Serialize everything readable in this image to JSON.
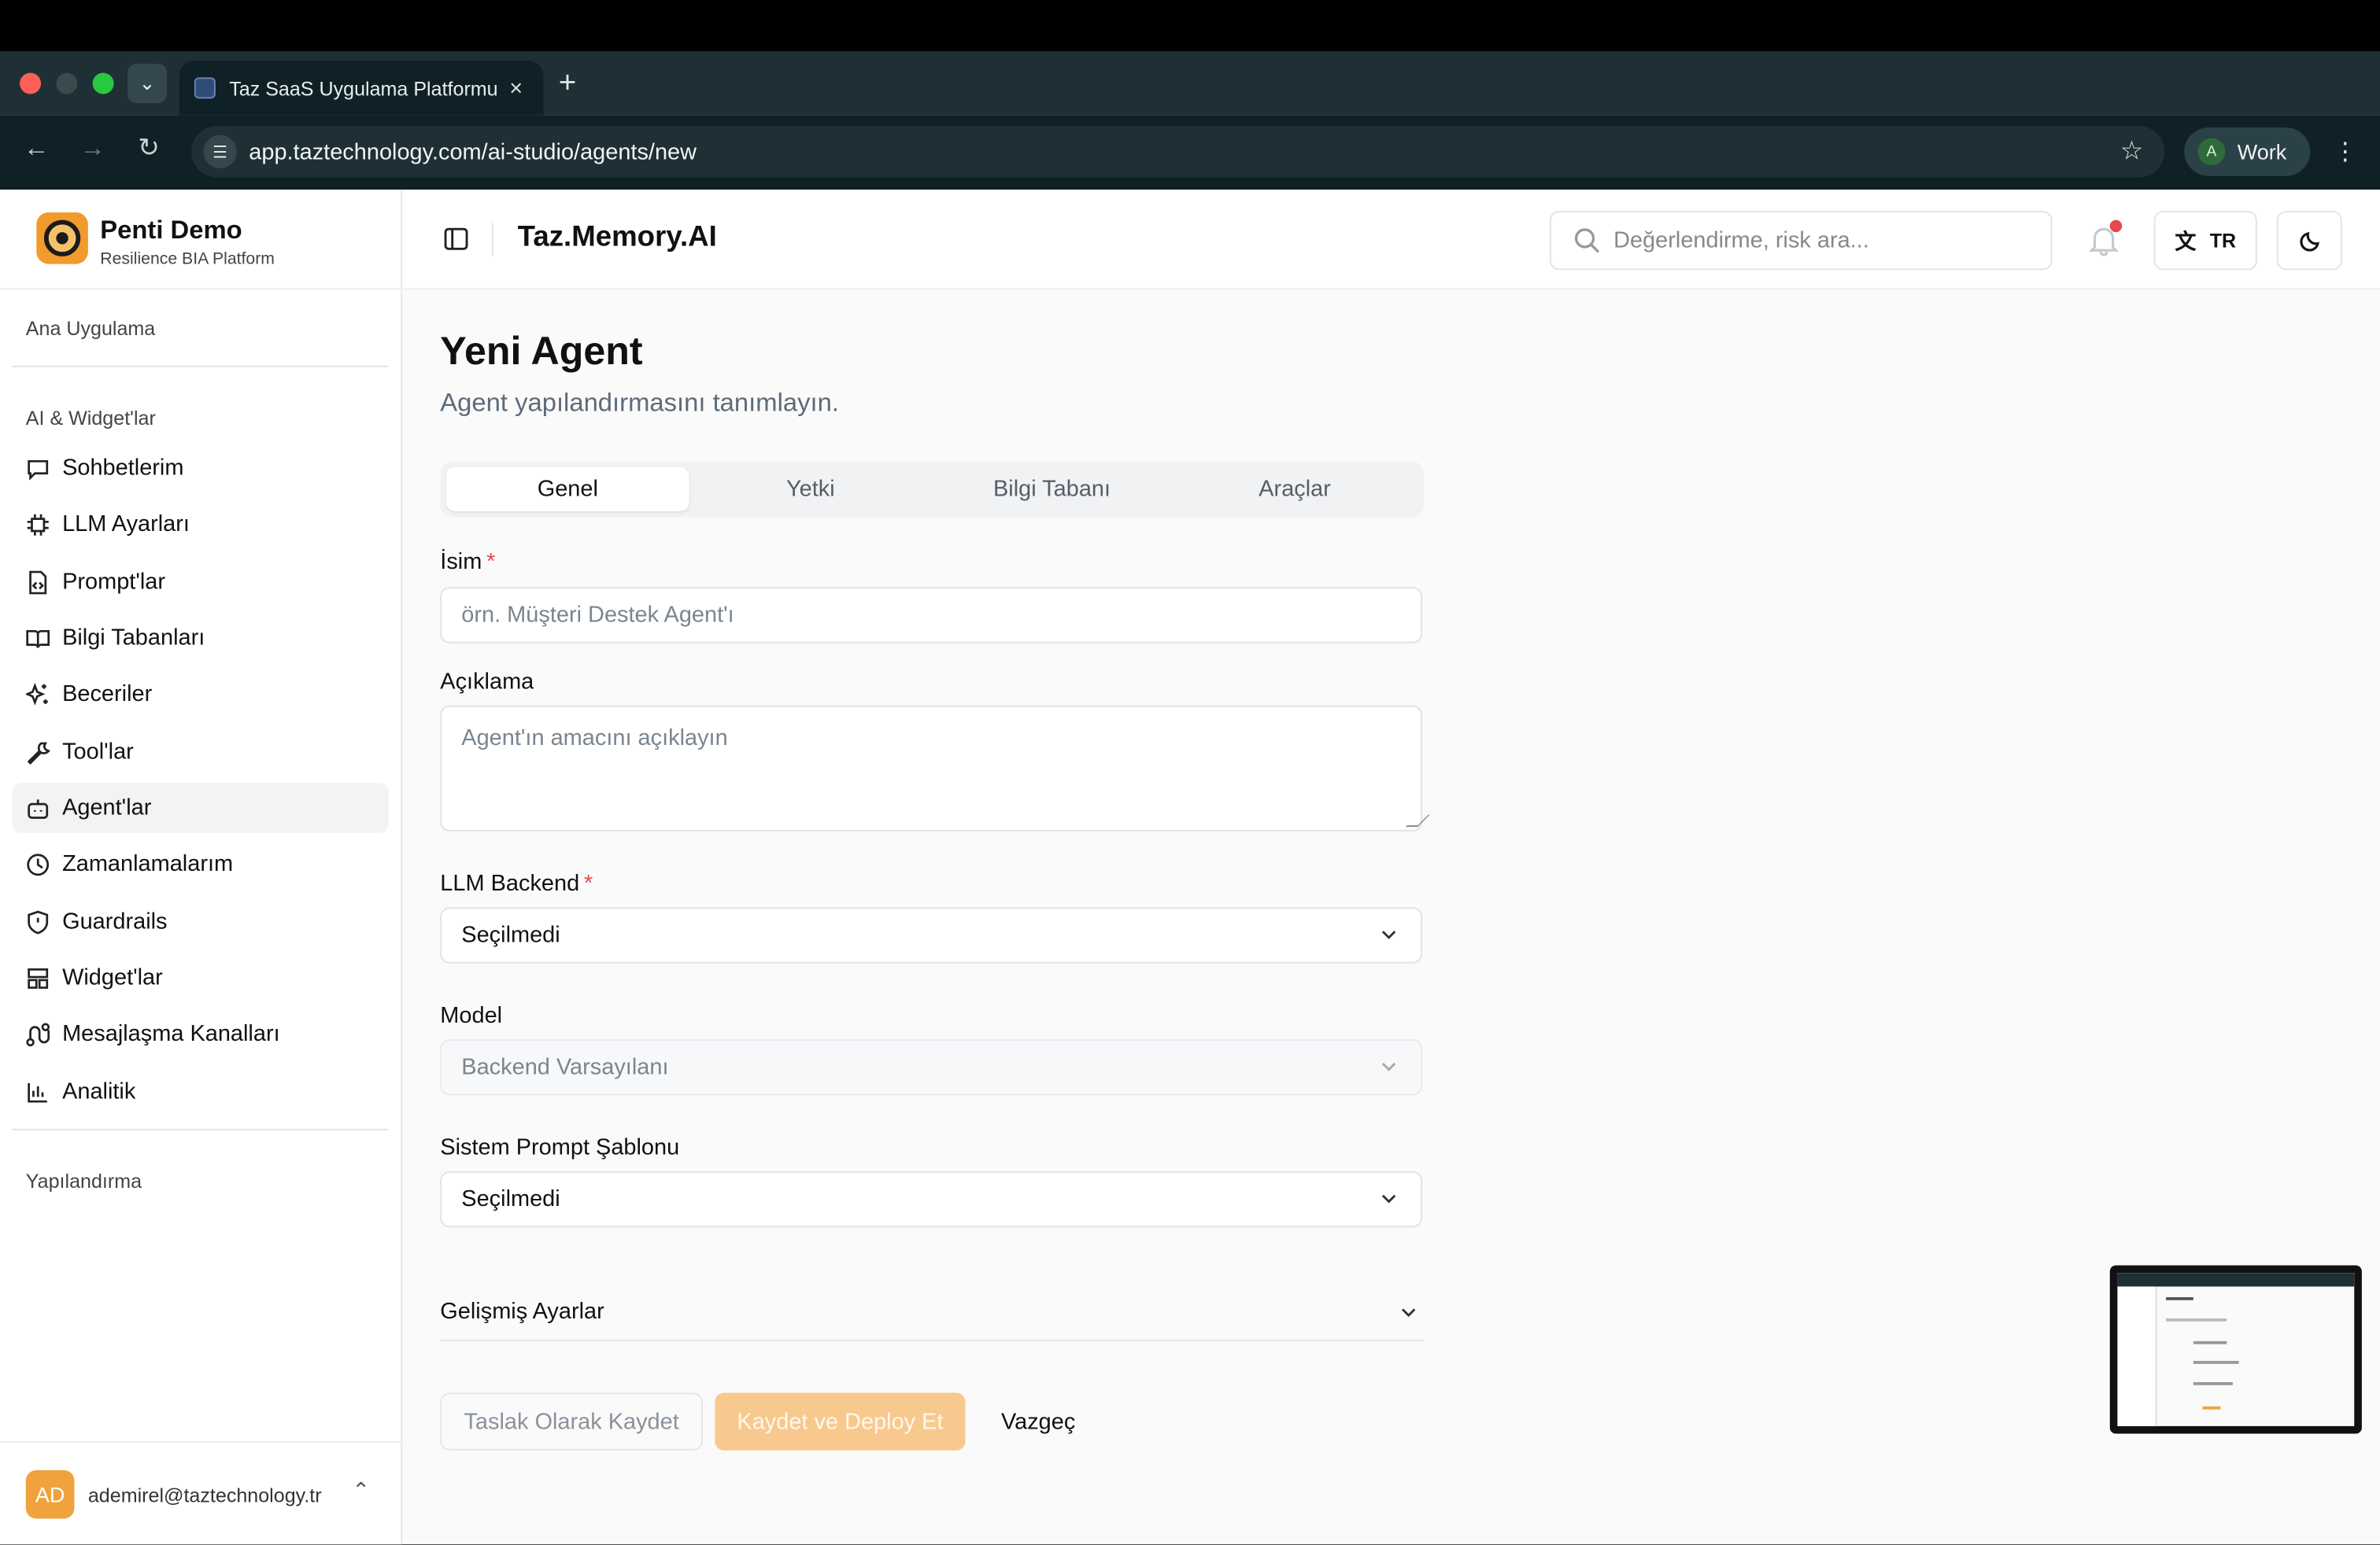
{
  "browser": {
    "tab_title": "Taz SaaS Uygulama Platformu",
    "url": "app.taztechnology.com/ai-studio/agents/new",
    "profile_initial": "A",
    "profile_name": "Work"
  },
  "brand": {
    "name": "Penti Demo",
    "subtitle": "Resilience BIA Platform"
  },
  "sidebar": {
    "group_main": "Ana Uygulama",
    "group_ai": "AI & Widget'lar",
    "group_config": "Yapılandırma",
    "items": [
      {
        "label": "Sohbetlerim",
        "icon": "chat-icon"
      },
      {
        "label": "LLM Ayarları",
        "icon": "chip-icon"
      },
      {
        "label": "Prompt'lar",
        "icon": "file-code-icon"
      },
      {
        "label": "Bilgi Tabanları",
        "icon": "book-icon"
      },
      {
        "label": "Beceriler",
        "icon": "sparkles-icon"
      },
      {
        "label": "Tool'lar",
        "icon": "wrench-icon"
      },
      {
        "label": "Agent'lar",
        "icon": "bot-icon",
        "active": true
      },
      {
        "label": "Zamanlamalarım",
        "icon": "clock-icon"
      },
      {
        "label": "Guardrails",
        "icon": "shield-icon"
      },
      {
        "label": "Widget'lar",
        "icon": "layout-icon"
      },
      {
        "label": "Mesajlaşma Kanalları",
        "icon": "route-icon"
      },
      {
        "label": "Analitik",
        "icon": "bar-chart-icon"
      }
    ],
    "user_initials": "AD",
    "user_email": "ademirel@taztechnology.tr"
  },
  "header": {
    "title": "Taz.Memory.AI",
    "search_placeholder": "Değerlendirme, risk ara...",
    "lang": "TR"
  },
  "page": {
    "title": "Yeni Agent",
    "subtitle": "Agent yapılandırmasını tanımlayın.",
    "tabs": [
      "Genel",
      "Yetki",
      "Bilgi Tabanı",
      "Araçlar"
    ],
    "active_tab": "Genel"
  },
  "form": {
    "name_label": "İsim",
    "name_placeholder": "örn. Müşteri Destek Agent'ı",
    "desc_label": "Açıklama",
    "desc_placeholder": "Agent'ın amacını açıklayın",
    "backend_label": "LLM Backend",
    "backend_value": "Seçilmedi",
    "model_label": "Model",
    "model_value": "Backend Varsayılanı",
    "prompt_label": "Sistem Prompt Şablonu",
    "prompt_value": "Seçilmedi",
    "required_mark": "*",
    "advanced_label": "Gelişmiş Ayarlar"
  },
  "actions": {
    "draft": "Taslak Olarak Kaydet",
    "deploy": "Kaydet ve Deploy Et",
    "cancel": "Vazgeç"
  },
  "colors": {
    "accent": "#f29a2e",
    "deploy_disabled": "#f8c98f",
    "required": "#e5484d",
    "chrome_dark": "#0f2126"
  }
}
